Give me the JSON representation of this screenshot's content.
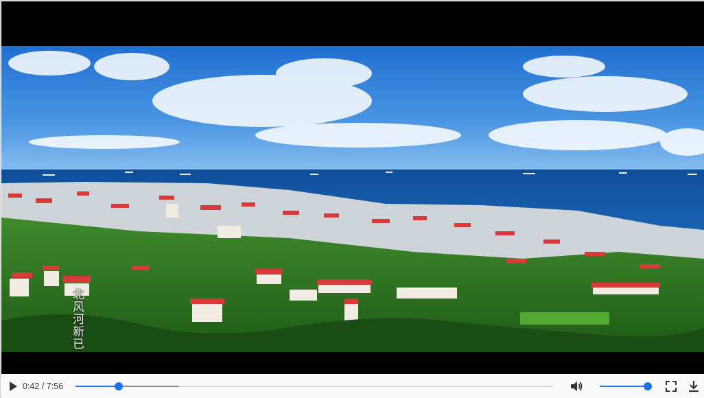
{
  "player": {
    "subtitle": "北风河新已",
    "current_time": "0:42",
    "separator": " / ",
    "duration": "7:56",
    "progress_fraction": 0.09,
    "buffered_fraction": 0.215,
    "volume_fraction": 1.0,
    "accent_color": "#1a73e8"
  },
  "icons": {
    "play": "play-icon",
    "volume": "volume-icon",
    "fullscreen": "fullscreen-icon",
    "download": "download-icon"
  }
}
